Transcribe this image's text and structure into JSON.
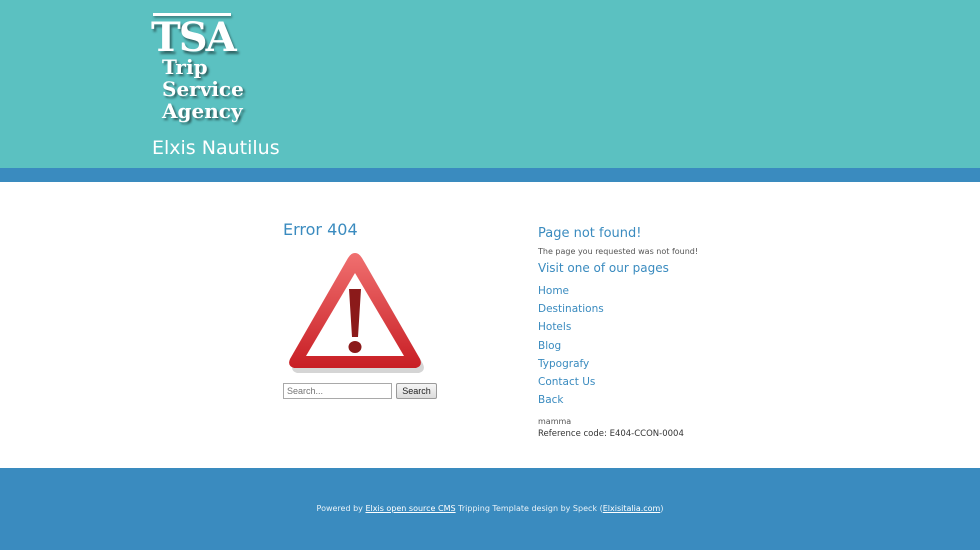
{
  "header": {
    "logo_mark": "TSA",
    "logo_lines": [
      "Trip",
      "Service",
      "Agency"
    ],
    "site_name": "Elxis Nautilus",
    "background_color": "#5bc1c1",
    "stripe_color": "#3a8bbf"
  },
  "error_block": {
    "title": "Error 404",
    "icon": "warning-triangle-icon",
    "search": {
      "placeholder": "Search...",
      "button_label": "Search"
    }
  },
  "info_block": {
    "title": "Page not found!",
    "message": "The page you requested was not found!",
    "visit_title": "Visit one of our pages",
    "links": [
      "Home",
      "Destinations",
      "Hotels",
      "Blog",
      "Typografy",
      "Contact Us",
      "Back"
    ],
    "meta_text": "mamma",
    "reference_code": "Reference code: E404-CCON-0004"
  },
  "footer": {
    "powered_by": "Powered by",
    "cms_link": "Elxis open source CMS",
    "template_text": "Tripping Template design by Speck (",
    "designer_link": "Elxisitalia.com",
    "closing": ")",
    "background_color": "#3a8bbf"
  }
}
